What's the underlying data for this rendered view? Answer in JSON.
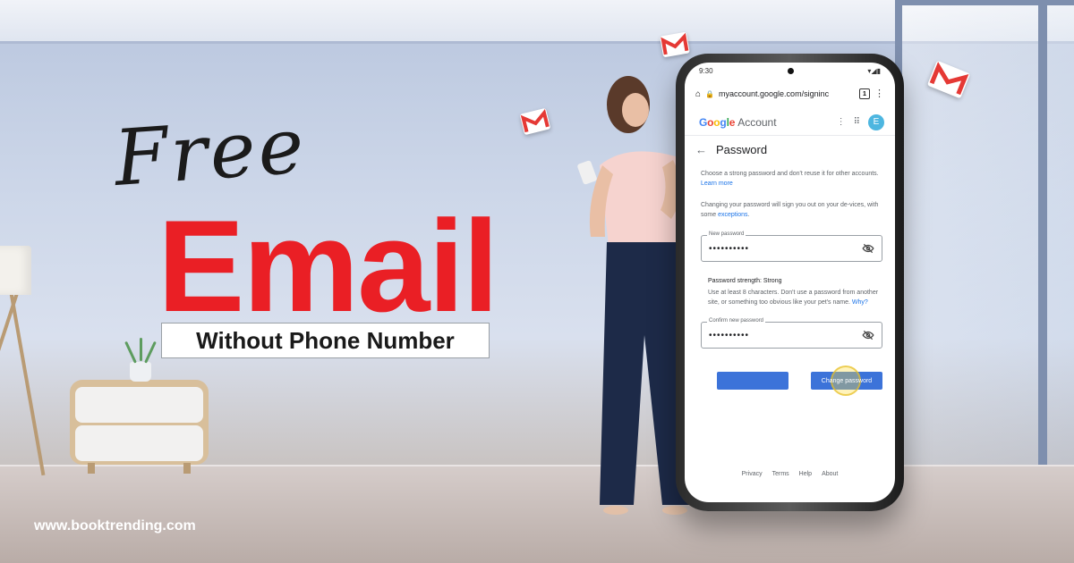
{
  "headline": {
    "script_word": "Free",
    "main_word": "Email",
    "subtitle": "Without Phone Number"
  },
  "website": "www.booktrending.com",
  "colors": {
    "headline_red": "#ea1f25",
    "google_blue": "#1a73e8",
    "button_blue": "#3c73d9",
    "avatar_blue": "#4db6e0"
  },
  "phone": {
    "status_time": "9:30",
    "url": "myaccount.google.com/signinc",
    "tab_count": "1",
    "account_header": {
      "logo": "Google",
      "label": "Account",
      "avatar_letter": "E"
    },
    "page_title": "Password",
    "intro_text": "Choose a strong password and don't reuse it for other accounts.",
    "intro_link": "Learn more",
    "signout_text": "Changing your password will sign you out on your de-vices, with some",
    "signout_link": "exceptions",
    "signout_end": ".",
    "new_password": {
      "label": "New password",
      "value": "••••••••••"
    },
    "strength_label": "Password strength: Strong",
    "strength_help": "Use at least 8 characters. Don't use a password from another site, or something too obvious like your pet's name.",
    "strength_link": "Why?",
    "confirm_password": {
      "label": "Confirm new password",
      "value": "••••••••••"
    },
    "left_button_label": "",
    "change_button_label": "Change password",
    "footer_links": [
      "Privacy",
      "Terms",
      "Help",
      "About"
    ]
  }
}
